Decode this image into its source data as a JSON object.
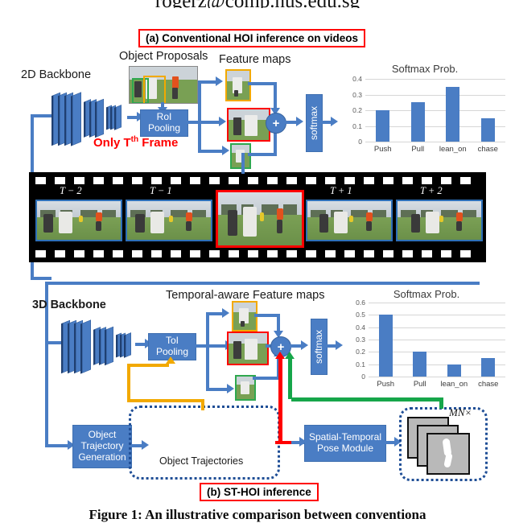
{
  "page": {
    "header_email": "rogerz@comp.nus.edu.sg",
    "caption": "Figure 1: An illustrative comparison between conventiona"
  },
  "panel_a": {
    "title": "(a) Conventional HOI inference on videos",
    "backbone_label": "2D Backbone",
    "object_proposals_label": "Object Proposals",
    "feature_maps_label": "Feature maps",
    "pooling_label": "RoI\nPooling",
    "pooling_line1": "RoI",
    "pooling_line2": "Pooling",
    "only_frame_note": "Only T",
    "only_frame_sup": "th",
    "only_frame_tail": " Frame",
    "sum_symbol": "+",
    "softmax_label": "softmax"
  },
  "panel_b": {
    "title": "(b) ST-HOI inference",
    "backbone_label": "3D Backbone",
    "feature_maps_label": "Temporal-aware Feature maps",
    "pooling_line1": "ToI",
    "pooling_line2": "Pooling",
    "sum_symbol": "+",
    "softmax_label": "softmax",
    "trajectory_gen_line1": "Object",
    "trajectory_gen_line2": "Trajectory",
    "trajectory_gen_line3": "Generation",
    "object_trajectories_label": "Object Trajectories",
    "pose_module_line1": "Spatial-Temporal",
    "pose_module_line2": "Pose Module",
    "pose_count_label": "MN×"
  },
  "filmstrip": {
    "frames": [
      {
        "label": "T − 2",
        "highlight": false
      },
      {
        "label": "T − 1",
        "highlight": false
      },
      {
        "label": "",
        "highlight": true
      },
      {
        "label": "T + 1",
        "highlight": false
      },
      {
        "label": "T + 2",
        "highlight": false
      }
    ]
  },
  "colors": {
    "accent_blue": "#4a7dc4",
    "highlight_red": "#ff0000",
    "green": "#16a64a",
    "orange": "#f2a900",
    "dark_blue": "#1f4e96"
  },
  "chart_data": [
    {
      "type": "bar",
      "id": "panel_a_softmax",
      "title": "Softmax Prob.",
      "categories": [
        "Push",
        "Pull",
        "lean_on",
        "chase"
      ],
      "values": [
        0.2,
        0.25,
        0.35,
        0.15
      ],
      "ylim": [
        0,
        0.4
      ],
      "yticks": [
        "0",
        "0.1",
        "0.2",
        "0.3",
        "0.4"
      ],
      "ytick_values": [
        0,
        0.1,
        0.2,
        0.3,
        0.4
      ],
      "xlabel": "",
      "ylabel": "",
      "grid": true,
      "legend": false
    },
    {
      "type": "bar",
      "id": "panel_b_softmax",
      "title": "Softmax Prob.",
      "categories": [
        "Push",
        "Pull",
        "lean_on",
        "chase"
      ],
      "values": [
        0.5,
        0.2,
        0.1,
        0.15
      ],
      "ylim": [
        0,
        0.6
      ],
      "yticks": [
        "0",
        "0.1",
        "0.2",
        "0.3",
        "0.4",
        "0.5",
        "0.6"
      ],
      "ytick_values": [
        0,
        0.1,
        0.2,
        0.3,
        0.4,
        0.5,
        0.6
      ],
      "xlabel": "",
      "ylabel": "",
      "grid": true,
      "legend": false
    }
  ]
}
